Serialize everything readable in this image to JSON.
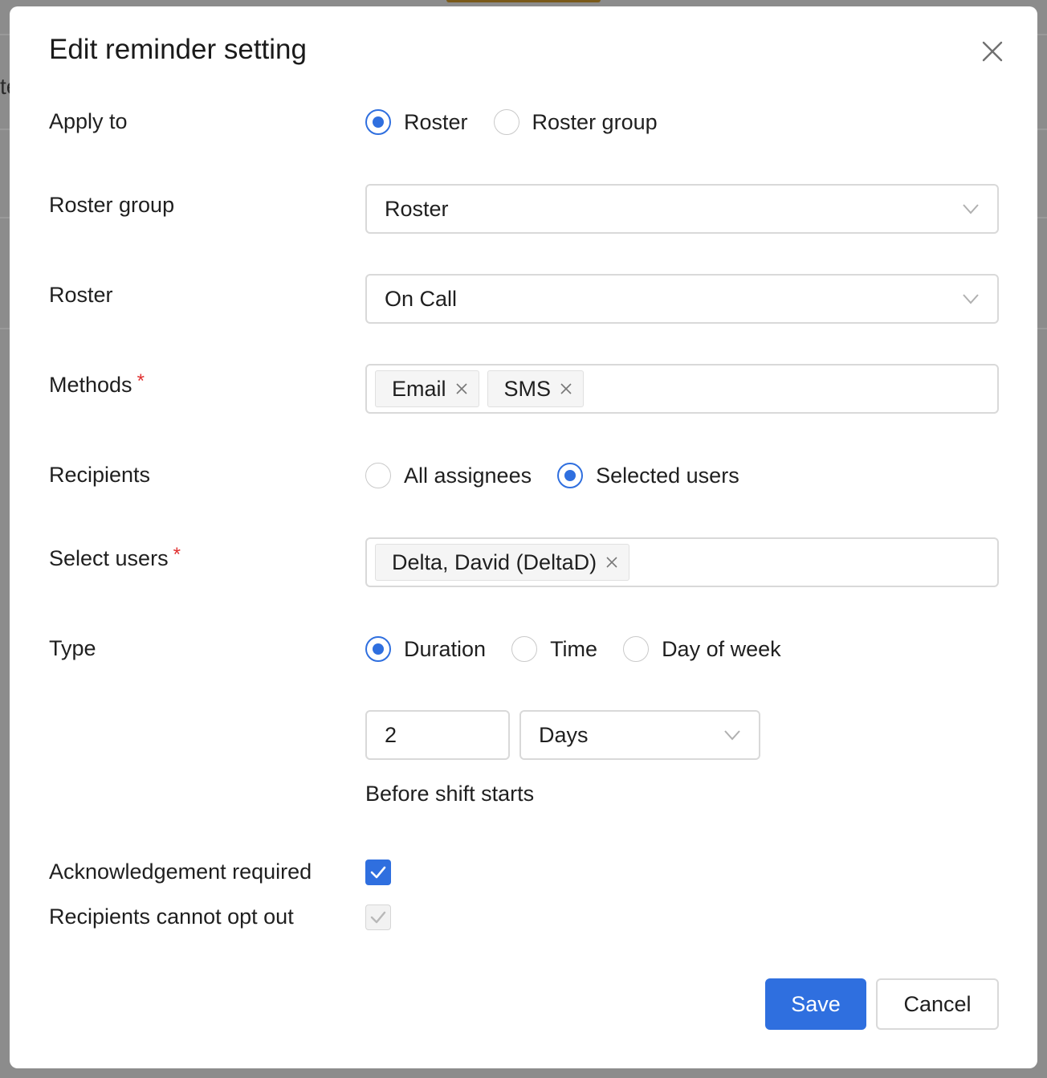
{
  "background": {
    "partial_letter": "te"
  },
  "modal": {
    "title": "Edit reminder setting"
  },
  "apply_to": {
    "label": "Apply to",
    "options": [
      "Roster",
      "Roster group"
    ],
    "selected": "Roster"
  },
  "roster_group": {
    "label": "Roster group",
    "value": "Roster"
  },
  "roster": {
    "label": "Roster",
    "value": "On Call"
  },
  "methods": {
    "label": "Methods",
    "required_mark": "*",
    "tags": [
      "Email",
      "SMS"
    ]
  },
  "recipients": {
    "label": "Recipients",
    "options": [
      "All assignees",
      "Selected users"
    ],
    "selected": "Selected users"
  },
  "select_users": {
    "label": "Select users",
    "required_mark": "*",
    "tags": [
      "Delta, David (DeltaD)"
    ]
  },
  "type": {
    "label": "Type",
    "options": [
      "Duration",
      "Time",
      "Day of week"
    ],
    "selected": "Duration",
    "amount": "2",
    "unit": "Days",
    "hint": "Before shift starts"
  },
  "acknowledgement": {
    "label": "Acknowledgement required",
    "checked": true
  },
  "opt_out": {
    "label": "Recipients cannot opt out",
    "checked": true,
    "disabled": true
  },
  "buttons": {
    "save": "Save",
    "cancel": "Cancel"
  },
  "colors": {
    "primary": "#2f6fdf",
    "required": "#e03030",
    "border": "#d9d9d9"
  }
}
